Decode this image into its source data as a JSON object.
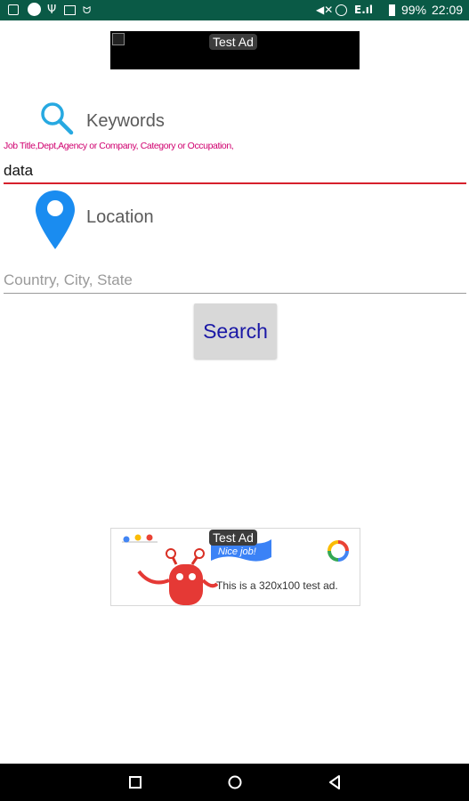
{
  "status_bar": {
    "battery": "99%",
    "time": "22:09",
    "icons": [
      "notification-icon",
      "vpn-icon",
      "usb-icon",
      "card-icon",
      "android-icon",
      "mute-icon",
      "alarm-icon",
      "signal-icon",
      "battery-icon"
    ]
  },
  "ads": {
    "top": {
      "label": "Test Ad"
    },
    "bottom": {
      "label": "Test Ad",
      "badge": "Nice job!",
      "text": "This is a 320x100 test ad."
    }
  },
  "keywords": {
    "label": "Keywords",
    "hint": "Job Title,Dept,Agency or Company, Category or Occupation,",
    "value": "data"
  },
  "location": {
    "label": "Location",
    "placeholder": "Country, City, State",
    "value": ""
  },
  "search_button": {
    "label": "Search"
  },
  "colors": {
    "status_bar": "#0a5a46",
    "hint": "#d0006f",
    "input_underline": "#d6202c",
    "search_text": "#1a18a6",
    "location_pin": "#1a8cf0",
    "search_icon": "#27a9e1"
  },
  "nav_bar": {
    "icons": [
      "recent-apps-icon",
      "home-icon",
      "back-icon"
    ]
  }
}
